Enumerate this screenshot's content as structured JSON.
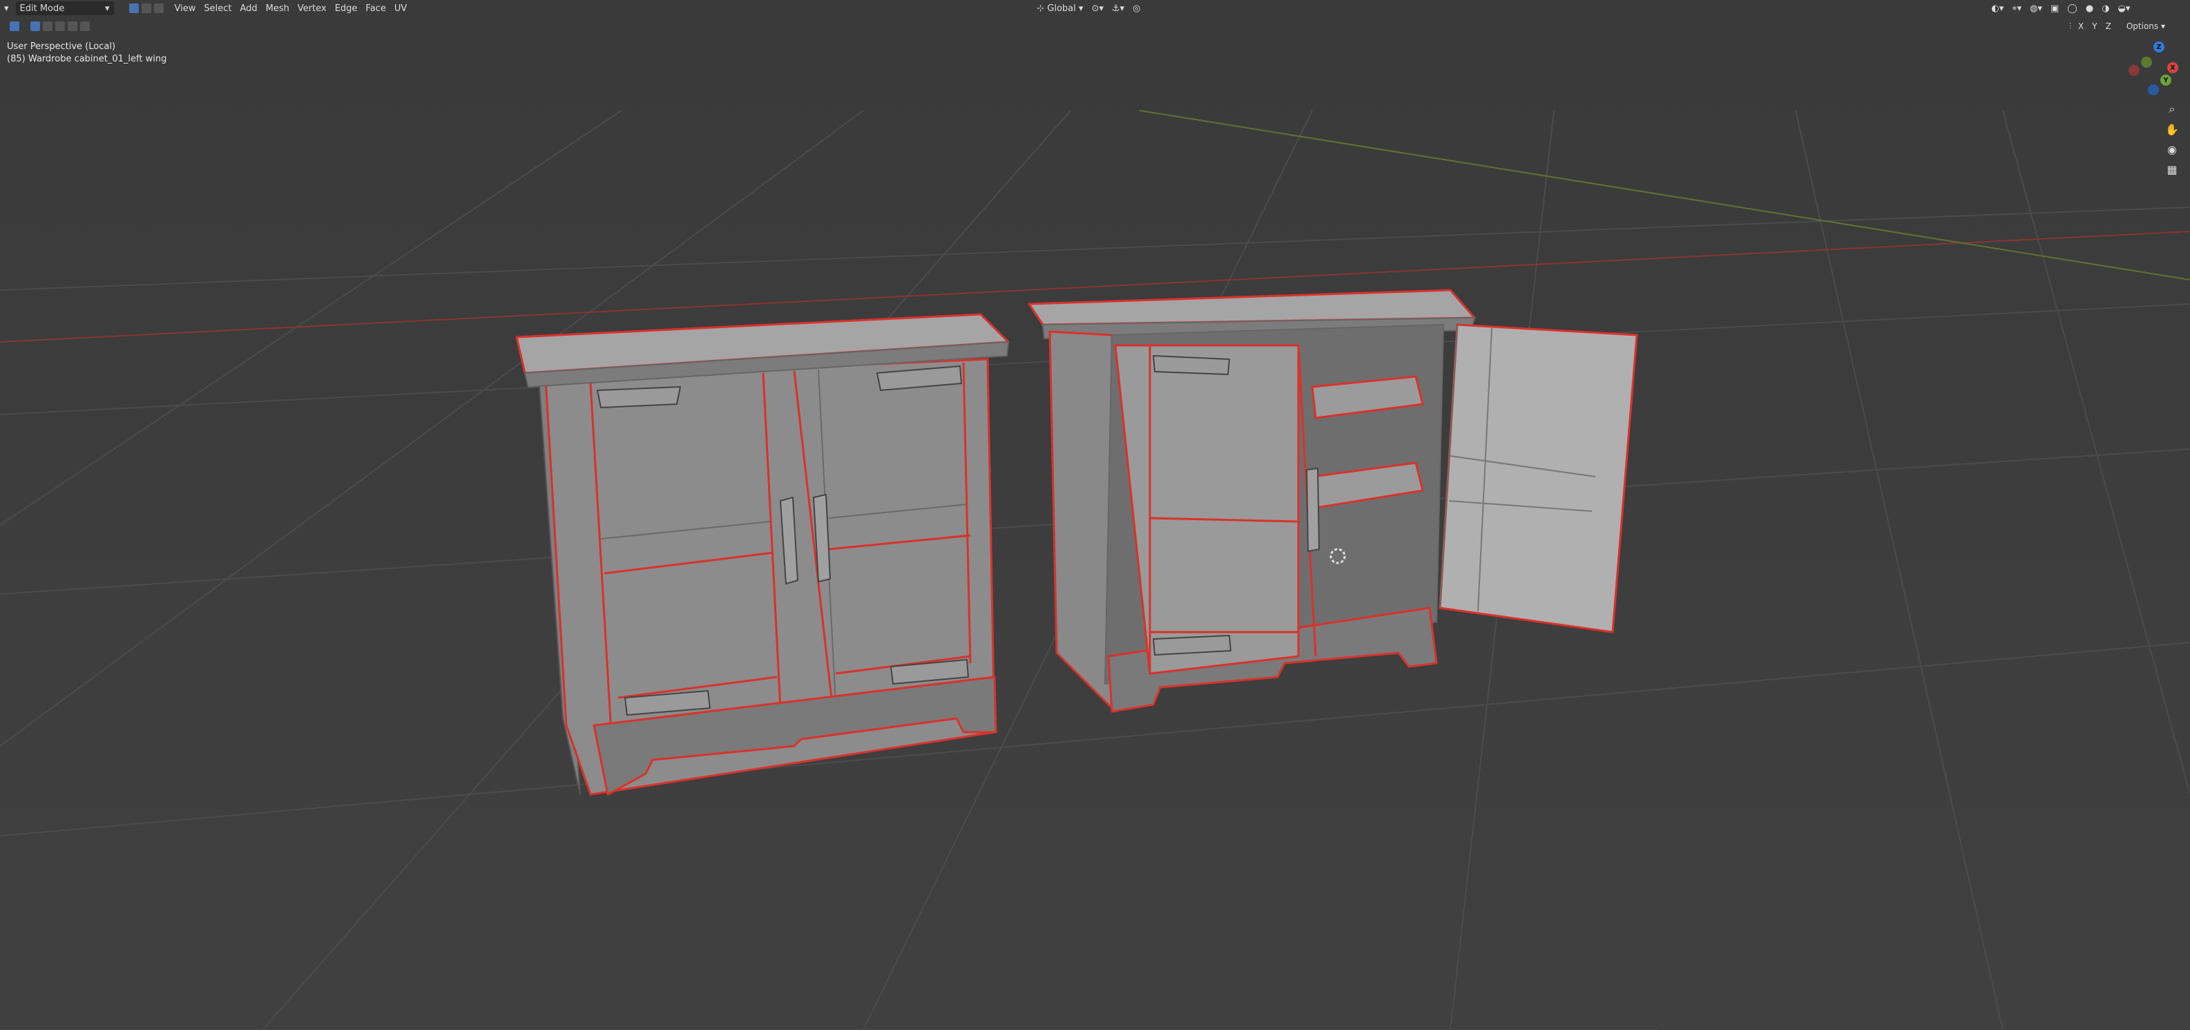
{
  "header": {
    "mode": "Edit Mode",
    "menus": [
      "View",
      "Select",
      "Add",
      "Mesh",
      "Vertex",
      "Edge",
      "Face",
      "UV"
    ],
    "transform_orientation": "Global",
    "options_label": "Options",
    "axis_labels": [
      "X",
      "Y",
      "Z"
    ]
  },
  "viewport": {
    "perspective_label": "User Perspective (Local)",
    "object_label": "(85) Wardrobe cabinet_01_left wing"
  },
  "gizmo": {
    "x": "X",
    "y": "Y",
    "z": "Z"
  },
  "icons": [
    "editor-type-icon",
    "mode-icon",
    "vertex-select-icon",
    "edge-select-icon",
    "face-select-icon",
    "snap-icon",
    "proportional-icon",
    "zoom-icon",
    "hand-icon",
    "camera-icon",
    "grid-icon"
  ],
  "colors": {
    "background": "#3d3d3d",
    "seam": "#d9322b",
    "mesh": "#8f8f8f",
    "accent": "#4772b3"
  }
}
